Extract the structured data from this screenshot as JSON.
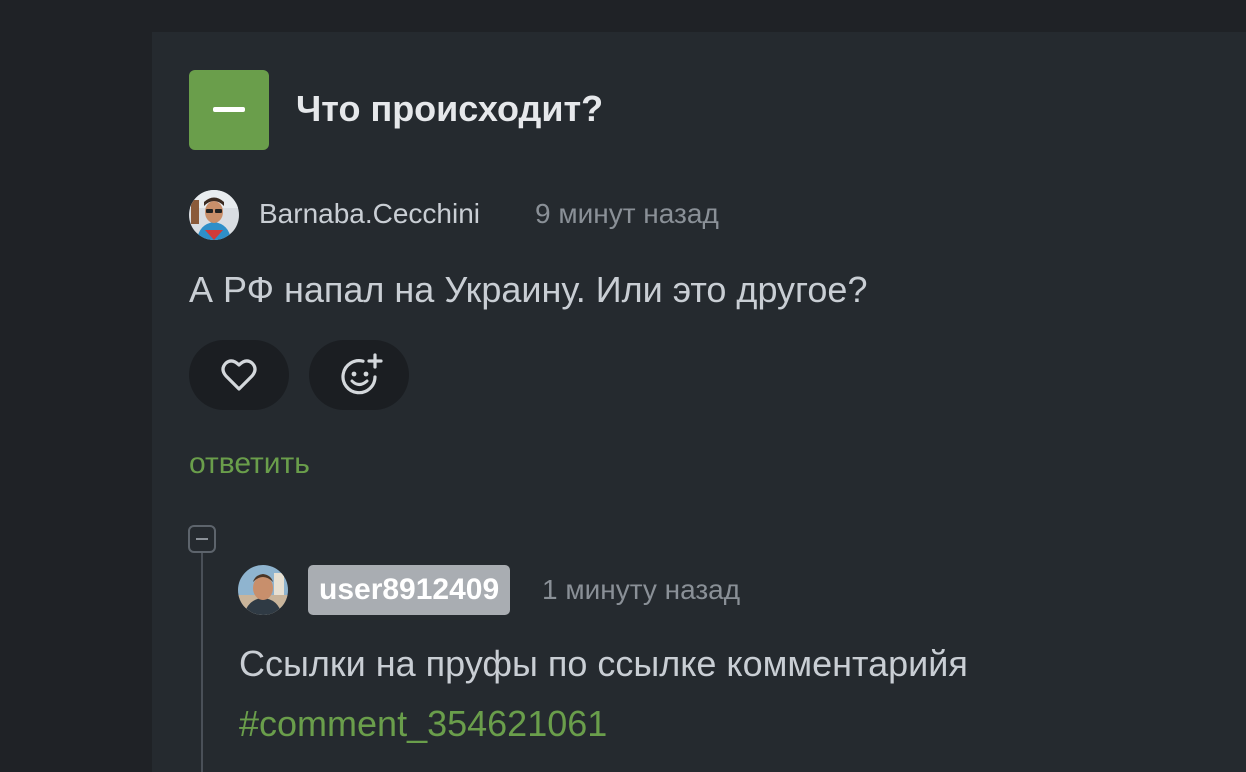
{
  "thread": {
    "title": "Что происходит?"
  },
  "comment1": {
    "author": "Barnaba.Cecchini",
    "time": "9 минут назад",
    "text": "А РФ напал на Украину. Или это другое?",
    "reply_label": "ответить"
  },
  "comment2": {
    "author": "user8912409",
    "time": "1 минуту назад",
    "text": "Ссылки на пруфы по ссылке комментарийя",
    "link": "#comment_354621061"
  },
  "colors": {
    "accent": "#6a9e4b",
    "background": "#1f2226",
    "panel": "#252a2f"
  }
}
